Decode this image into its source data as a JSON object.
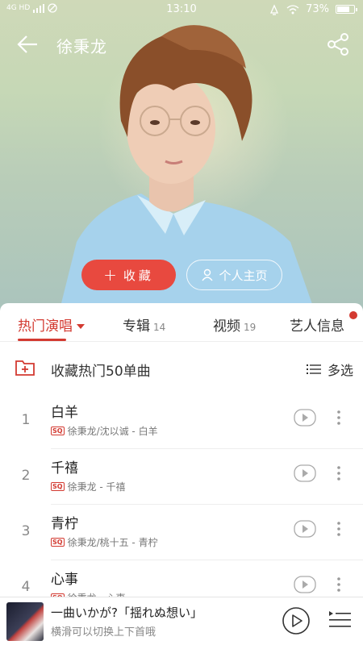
{
  "status": {
    "signal": "4G HD",
    "time": "13:10",
    "battery": "73%",
    "battery_level": 0.73
  },
  "header": {
    "artist": "徐秉龙"
  },
  "actions": {
    "collect_label": "收藏",
    "collect_icon": "+",
    "homepage_label": "个人主页"
  },
  "tabs": [
    {
      "label": "热门演唱",
      "count": ""
    },
    {
      "label": "专辑",
      "count": "14"
    },
    {
      "label": "视频",
      "count": "19"
    },
    {
      "label": "艺人信息",
      "count": ""
    }
  ],
  "collect_row": {
    "label": "收藏热门50单曲",
    "multi_select": "多选"
  },
  "quality_badge": "SQ",
  "songs": [
    {
      "index": "1",
      "title": "白羊",
      "subtitle": "徐秉龙/沈以诚 - 白羊"
    },
    {
      "index": "2",
      "title": "千禧",
      "subtitle": "徐秉龙 - 千禧"
    },
    {
      "index": "3",
      "title": "青柠",
      "subtitle": "徐秉龙/桃十五 - 青柠"
    },
    {
      "index": "4",
      "title": "心事",
      "subtitle": "徐秉龙 - 心事"
    }
  ],
  "player": {
    "title": "一曲いかが?「揺れぬ想い」",
    "hint": "横滑可以切换上下首哦"
  },
  "colors": {
    "accent": "#d33a31",
    "collect_button": "#e8493f"
  }
}
